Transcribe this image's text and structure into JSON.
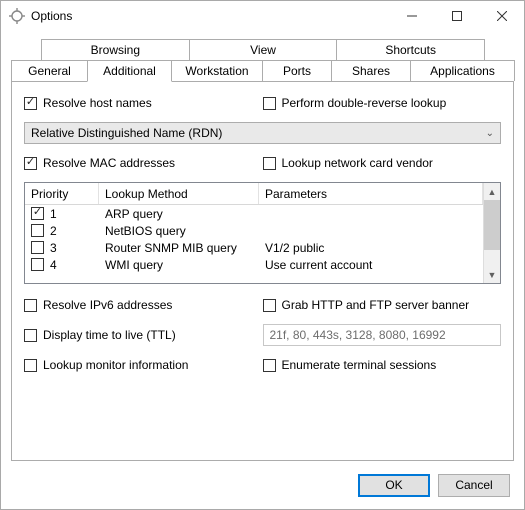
{
  "window": {
    "title": "Options"
  },
  "tabs": {
    "row1": [
      "Browsing",
      "View",
      "Shortcuts"
    ],
    "row2": [
      "General",
      "Additional",
      "Workstation",
      "Ports",
      "Shares",
      "Applications"
    ],
    "active": "Additional"
  },
  "options": {
    "resolve_host_names": {
      "label": "Resolve host names",
      "checked": true
    },
    "double_reverse": {
      "label": "Perform double-reverse lookup",
      "checked": false
    },
    "name_format_select": "Relative Distinguished Name (RDN)",
    "resolve_mac": {
      "label": "Resolve MAC addresses",
      "checked": true
    },
    "lookup_vendor": {
      "label": "Lookup network card vendor",
      "checked": false
    },
    "resolve_ipv6": {
      "label": "Resolve IPv6 addresses",
      "checked": false
    },
    "grab_banner": {
      "label": "Grab HTTP and FTP server banner",
      "checked": false
    },
    "display_ttl": {
      "label": "Display time to live (TTL)",
      "checked": false
    },
    "ports_value": "21f, 80, 443s, 3128, 8080, 16992",
    "lookup_monitor": {
      "label": "Lookup monitor information",
      "checked": false
    },
    "enumerate_sessions": {
      "label": "Enumerate terminal sessions",
      "checked": false
    }
  },
  "lookup_table": {
    "headers": {
      "priority": "Priority",
      "method": "Lookup Method",
      "params": "Parameters"
    },
    "rows": [
      {
        "checked": true,
        "priority": "1",
        "method": "ARP query",
        "params": ""
      },
      {
        "checked": false,
        "priority": "2",
        "method": "NetBIOS query",
        "params": ""
      },
      {
        "checked": false,
        "priority": "3",
        "method": "Router SNMP MIB query",
        "params": "V1/2 public"
      },
      {
        "checked": false,
        "priority": "4",
        "method": "WMI query",
        "params": "Use current account"
      }
    ]
  },
  "buttons": {
    "ok": "OK",
    "cancel": "Cancel"
  }
}
